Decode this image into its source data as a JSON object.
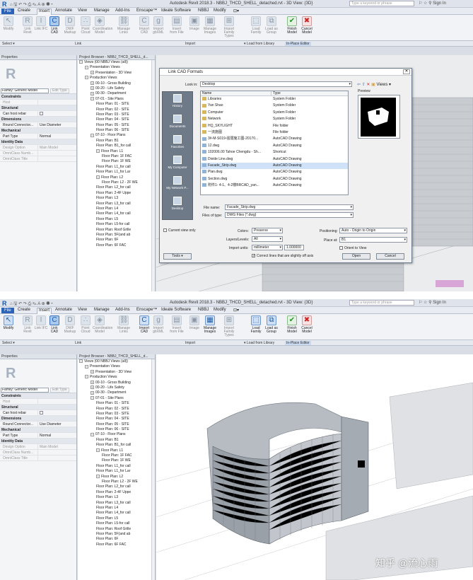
{
  "app": {
    "title": "Autodesk Revit 2018.3 -    NBBJ_THCD_SHELL_detached.rvt - 3D View: {3D}",
    "search_placeholder": "Type a keyword or phrase",
    "sign_in": "Sign In",
    "qat": "⌂ 🖫 ↶ ↷ ⎙ ✎ A ⊕ ◉ ▾"
  },
  "menu": [
    "File",
    "Create",
    "Insert",
    "Annotate",
    "View",
    "Manage",
    "Add-Ins",
    "Enscape™",
    "Ideate Software",
    "NBBJ",
    "Modify",
    "⊡▾"
  ],
  "ribbon": {
    "buttons": [
      {
        "label": "Modify",
        "icon": "↖"
      },
      {
        "label": "Link Revit",
        "icon": "R"
      },
      {
        "label": "Link IFC",
        "icon": "I"
      },
      {
        "label": "Link CAD",
        "icon": "C"
      },
      {
        "label": "DWF Markup",
        "icon": "D"
      },
      {
        "label": "Point Cloud",
        "icon": "∴"
      },
      {
        "label": "Coordination Model",
        "icon": "◈"
      },
      {
        "label": "Manage Links",
        "icon": "⛓"
      },
      {
        "label": "Import CAD",
        "icon": "C"
      },
      {
        "label": "Import gbXML",
        "icon": "g"
      },
      {
        "label": "Insert from File",
        "icon": "▤"
      },
      {
        "label": "Image",
        "icon": "▣"
      },
      {
        "label": "Manage Images",
        "icon": "▦"
      },
      {
        "label": "Import Family Types",
        "icon": "⊞"
      },
      {
        "label": "Load Family",
        "icon": "⬚"
      },
      {
        "label": "Load as Group",
        "icon": "⧉"
      },
      {
        "label": "Finish Model",
        "icon": "✔"
      },
      {
        "label": "Cancel Model",
        "icon": "✖"
      }
    ],
    "panel_select": "Select ▾",
    "panel_link": "Link",
    "panel_import": "Import",
    "panel_load": "▾  Load from Library",
    "panel_inplace": "In-Place Editor"
  },
  "properties": {
    "header": "Properties",
    "family_select": "Family: Generic Model",
    "edit_type": "Edit Type",
    "rows": [
      {
        "type": "cat",
        "k": "Constraints"
      },
      {
        "type": "gray",
        "k": "Host",
        "v": ""
      },
      {
        "type": "cat",
        "k": "Structural"
      },
      {
        "type": "row",
        "k": "Can host rebar",
        "v": "checkbox"
      },
      {
        "type": "cat",
        "k": "Dimensions"
      },
      {
        "type": "row",
        "k": "Round Connector...",
        "v": "Use Diameter"
      },
      {
        "type": "cat",
        "k": "Mechanical"
      },
      {
        "type": "row",
        "k": "Part Type",
        "v": "Normal"
      },
      {
        "type": "cat",
        "k": "Identity Data"
      },
      {
        "type": "gray",
        "k": "Design Option",
        "v": "Main Model"
      },
      {
        "type": "gray",
        "k": "OmniClass Numb...",
        "v": ""
      },
      {
        "type": "gray",
        "k": "OmniClass Title",
        "v": ""
      }
    ]
  },
  "browser": {
    "header": "Project Browser - NBBJ_THCD_SHELL_d...",
    "items": [
      {
        "t": "Views (00 NBBJ Views (all))",
        "d": 0,
        "g": "−"
      },
      {
        "t": "Presentation Views",
        "d": 1,
        "g": "−"
      },
      {
        "t": "Presentation - 3D View",
        "d": 2,
        "g": "+"
      },
      {
        "t": "Production Views",
        "d": 1,
        "g": "−"
      },
      {
        "t": "00-10 - Gross Building",
        "d": 2,
        "g": "+"
      },
      {
        "t": "00-20 - Life Safety",
        "d": 2,
        "g": "+"
      },
      {
        "t": "00-30 - Department",
        "d": 2,
        "g": "+"
      },
      {
        "t": "07-01 - Site Plans",
        "d": 2,
        "g": "−"
      },
      {
        "t": "Floor Plan: 01 - SITE",
        "d": 3,
        "g": ""
      },
      {
        "t": "Floor Plan: 02 - SITE",
        "d": 3,
        "g": ""
      },
      {
        "t": "Floor Plan: 03 - SITE",
        "d": 3,
        "g": ""
      },
      {
        "t": "Floor Plan: 04 - SITE",
        "d": 3,
        "g": ""
      },
      {
        "t": "Floor Plan: 05 - SITE",
        "d": 3,
        "g": ""
      },
      {
        "t": "Floor Plan: 06 - SITE",
        "d": 3,
        "g": ""
      },
      {
        "t": "07-10 - Floor Plans",
        "d": 2,
        "g": "−"
      },
      {
        "t": "Floor Plan: B1",
        "d": 3,
        "g": ""
      },
      {
        "t": "Floor Plan: B1_for call",
        "d": 3,
        "g": ""
      },
      {
        "t": "Floor Plan: L1",
        "d": 3,
        "g": "−"
      },
      {
        "t": "Floor Plan: 1F FAC",
        "d": 4,
        "g": ""
      },
      {
        "t": "Floor Plan: 1F WE",
        "d": 4,
        "g": ""
      },
      {
        "t": "Floor Plan: L1_for call",
        "d": 3,
        "g": ""
      },
      {
        "t": "Floor Plan: L1_for Lar",
        "d": 3,
        "g": ""
      },
      {
        "t": "Floor Plan: L2",
        "d": 3,
        "g": "−"
      },
      {
        "t": "Floor Plan: L2 - 2F WE",
        "d": 4,
        "g": ""
      },
      {
        "t": "Floor Plan: L2_for call",
        "d": 3,
        "g": ""
      },
      {
        "t": "Floor Plan: 2-4F Uppe",
        "d": 3,
        "g": ""
      },
      {
        "t": "Floor Plan: L3",
        "d": 3,
        "g": ""
      },
      {
        "t": "Floor Plan: L3_for call",
        "d": 3,
        "g": ""
      },
      {
        "t": "Floor Plan: L4",
        "d": 3,
        "g": ""
      },
      {
        "t": "Floor Plan: L4_for call",
        "d": 3,
        "g": ""
      },
      {
        "t": "Floor Plan: L5",
        "d": 3,
        "g": ""
      },
      {
        "t": "Floor Plan: L5-for call",
        "d": 3,
        "g": ""
      },
      {
        "t": "Floor Plan: Roof Grille",
        "d": 3,
        "g": ""
      },
      {
        "t": "Floor Plan: 5F(and ab",
        "d": 3,
        "g": ""
      },
      {
        "t": "Floor Plan: 6F",
        "d": 3,
        "g": ""
      },
      {
        "t": "Floor Plan: 6F FAC",
        "d": 3,
        "g": ""
      }
    ]
  },
  "dialog": {
    "title": "Link CAD Formats",
    "look_in_label": "Look in:",
    "look_in_value": "Desktop",
    "preview_label": "Preview",
    "views_button": "Views ▾",
    "col_name": "Name",
    "col_type": "Type",
    "places": [
      "History",
      "Documents",
      "Favorites",
      "My Computer",
      "My Network P...",
      "Desktop"
    ],
    "files": [
      {
        "n": "Libraries",
        "t": "System Folder",
        "k": "folder"
      },
      {
        "n": "Yan Shao",
        "t": "System Folder",
        "k": "folder"
      },
      {
        "n": "Computer",
        "t": "System Folder",
        "k": "folder"
      },
      {
        "n": "Network",
        "t": "System Folder",
        "k": "folder"
      },
      {
        "n": "HQ_SKYLIGHT",
        "t": "File folder",
        "k": "folder"
      },
      {
        "n": "一流施图",
        "t": "File folder",
        "k": "folder"
      },
      {
        "n": "3#-M-S019-强弱施工图-20170...",
        "t": "AutoCAD Drawing",
        "k": "dwg"
      },
      {
        "n": "12.dwg",
        "t": "AutoCAD Drawing",
        "k": "dwg"
      },
      {
        "n": "102006.00 Tahoe Chengdu - Sh...",
        "t": "Shortcut",
        "k": "dwg"
      },
      {
        "n": "Divide Line.dwg",
        "t": "AutoCAD Drawing",
        "k": "dwg"
      },
      {
        "n": "Facade_Strip.dwg",
        "t": "AutoCAD Drawing",
        "k": "dwg",
        "sel": true
      },
      {
        "n": "Plan.dwg",
        "t": "AutoCAD Drawing",
        "k": "dwg"
      },
      {
        "n": "Section.dwg",
        "t": "AutoCAD Drawing",
        "k": "dwg"
      },
      {
        "n": "附件1- 4-1、4-2楼BRCAD_yan...",
        "t": "AutoCAD Drawing",
        "k": "dwg"
      }
    ],
    "file_name_label": "File name:",
    "file_name_value": "Facade_Strip.dwg",
    "file_type_label": "Files of type:",
    "file_type_value": "DWG Files (*.dwg)",
    "current_view_only": "Current view only",
    "colors_label": "Colors:",
    "colors_value": "Preserve",
    "layers_label": "Layers/Levels:",
    "layers_value": "All",
    "units_label": "Import units:",
    "units_value": "millimeter",
    "units_scale": "1.000000",
    "correct_lines": "Correct lines that are slightly off axis",
    "positioning_label": "Positioning:",
    "positioning_value": "Auto - Origin to Origin",
    "place_at_label": "Place at:",
    "place_at_value": "B1",
    "orient_to_view": "Orient to View",
    "tools_button": "Tools ▾",
    "open_button": "Open",
    "cancel_button": "Cancel"
  },
  "watermark": "知乎 @流心雨"
}
